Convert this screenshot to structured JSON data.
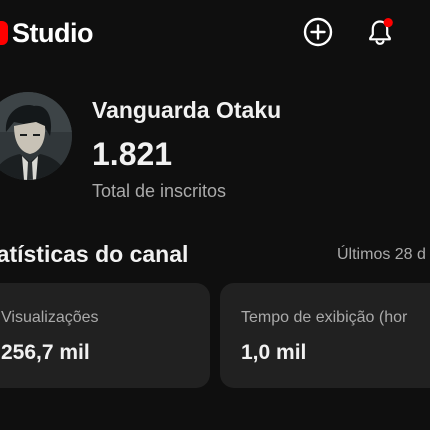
{
  "app": {
    "logo_text": "Studio",
    "logo_icon": "youtube-play-logo",
    "brand_color": "#ff0000"
  },
  "topbar": {
    "create_icon": "plus-circle-icon",
    "notifications_icon": "bell-icon",
    "notification_dot_color": "#ff0000"
  },
  "channel": {
    "name": "Vanguarda Otaku",
    "subscribers": "1.821",
    "subscribers_label": "Total de inscritos"
  },
  "analytics": {
    "title": "tatísticas do canal",
    "period": "Últimos 28 d",
    "cards": [
      {
        "label": "Visualizações",
        "value": "256,7 mil"
      },
      {
        "label": "Tempo de exibição (hor",
        "value": "1,0 mil"
      }
    ]
  }
}
